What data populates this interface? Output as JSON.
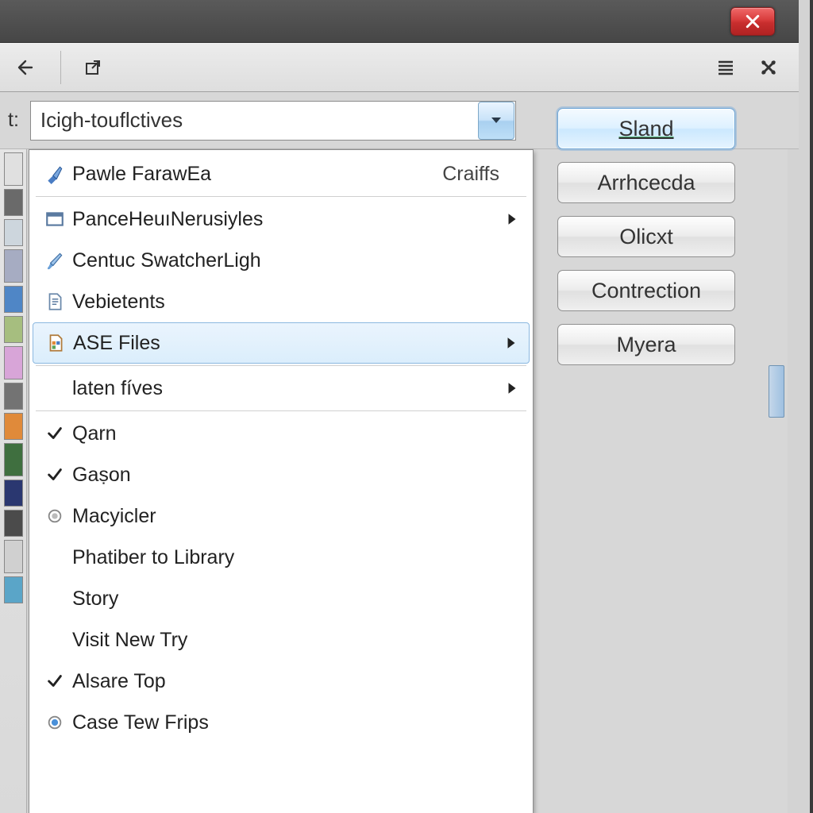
{
  "titlebar": {
    "close": "Close"
  },
  "toolbar": {
    "back": "Back",
    "open_dialog": "Open external",
    "menu_list": "Menu",
    "settings": "Settings"
  },
  "filter": {
    "label": "t:",
    "value": "Icigh-touflctives"
  },
  "buttons": {
    "primary": "Sland",
    "b2": "Arrhcecda",
    "b3": "Olicxt",
    "b4": "Contrection",
    "b5": "Myera"
  },
  "menu": {
    "items": [
      {
        "label": "Pawle FarawEa",
        "shortcut": "Craiffs",
        "icon": "brush",
        "submenu": false
      },
      {
        "sep": true
      },
      {
        "label": "PanceHeuıNerusiyles",
        "icon": "window",
        "submenu": true
      },
      {
        "label": "Centuc SwatcherLigh",
        "icon": "brush2",
        "submenu": false
      },
      {
        "label": "Vebietents",
        "icon": "doc",
        "submenu": false
      },
      {
        "label": "ASE Files",
        "icon": "swatch-doc",
        "submenu": true,
        "selected": true
      },
      {
        "sep": true
      },
      {
        "label": "laten fíves",
        "icon": "",
        "submenu": true
      },
      {
        "sep": true
      },
      {
        "label": "Qarn",
        "check": "check"
      },
      {
        "label": "Gaṣon",
        "check": "check"
      },
      {
        "label": "Macyicler",
        "check": "radio-off"
      },
      {
        "label": "Phatiber to Library"
      },
      {
        "label": "Story"
      },
      {
        "label": "Visit New Try"
      },
      {
        "label": "Alsare Top",
        "check": "check"
      },
      {
        "label": "Case Tew Frips",
        "check": "radio-on"
      }
    ]
  },
  "palette": [
    "#e0e0e0",
    "#6a6a6a",
    "#cdd6dd",
    "#a6acc2",
    "#4f86c6",
    "#a6be7f",
    "#d8a5d8",
    "#737373",
    "#e08a3a",
    "#3f6f3f",
    "#2a3770",
    "#4b4b4b",
    "#d0d0d0",
    "#5aa5c8"
  ]
}
